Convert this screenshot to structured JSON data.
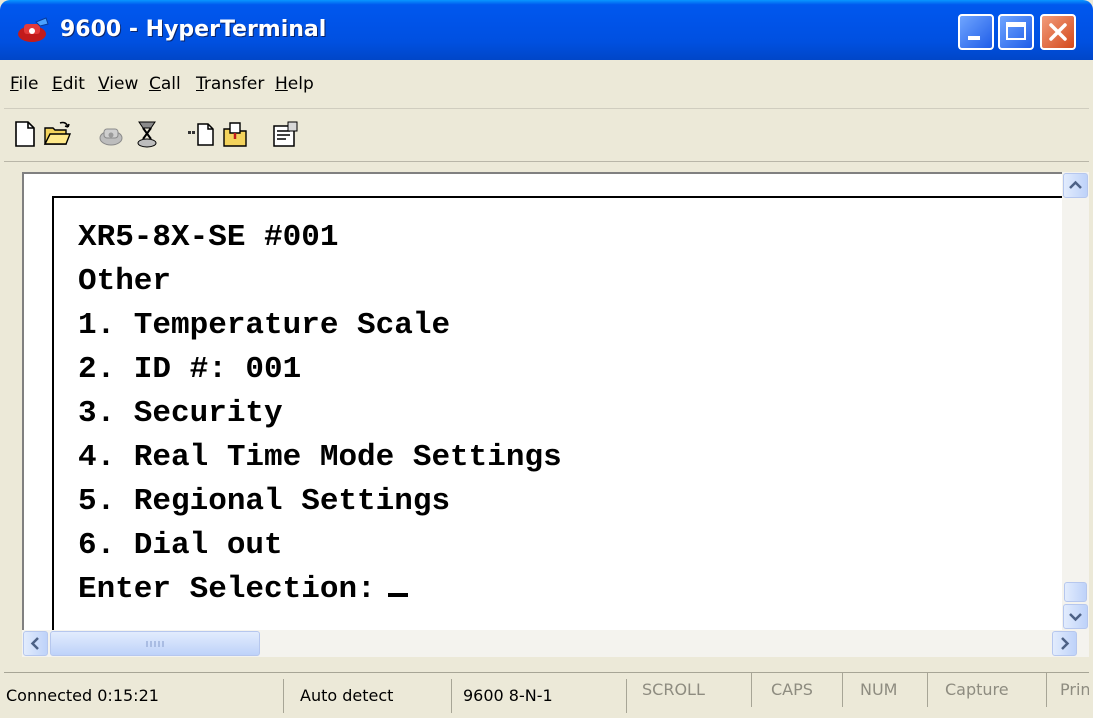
{
  "window": {
    "title": "9600 - HyperTerminal",
    "icon": "hyperterminal-phone-icon",
    "controls": [
      "minimize-icon",
      "maximize-icon",
      "close-icon"
    ]
  },
  "menu": {
    "items": [
      {
        "label": "File",
        "accel": "F",
        "rest": "ile"
      },
      {
        "label": "Edit",
        "accel": "E",
        "rest": "dit"
      },
      {
        "label": "View",
        "accel": "V",
        "rest": "iew"
      },
      {
        "label": "Call",
        "accel": "C",
        "rest": "all"
      },
      {
        "label": "Transfer",
        "accel": "T",
        "rest": "ransfer"
      },
      {
        "label": "Help",
        "accel": "H",
        "rest": "elp"
      }
    ]
  },
  "toolbar": {
    "icons": [
      "new-icon",
      "open-icon",
      "call-icon",
      "disconnect-icon",
      "send-icon",
      "receive-icon",
      "properties-icon"
    ]
  },
  "terminal": {
    "lines": [
      "XR5-8X-SE #001",
      "Other",
      "1. Temperature Scale",
      "2. ID #: 001",
      "3. Security",
      "4. Real Time Mode Settings",
      "5. Regional Settings",
      "6. Dial out",
      "Enter Selection:"
    ]
  },
  "status": {
    "connected": "Connected 0:15:21",
    "detect": "Auto detect",
    "port": "9600 8-N-1",
    "scroll": "SCROLL",
    "caps": "CAPS",
    "num": "NUM",
    "capture": "Capture",
    "print": "Print echo"
  },
  "colors": {
    "titlebar": "#0053e8",
    "chrome": "#ece9d8",
    "close": "#d4491a"
  }
}
